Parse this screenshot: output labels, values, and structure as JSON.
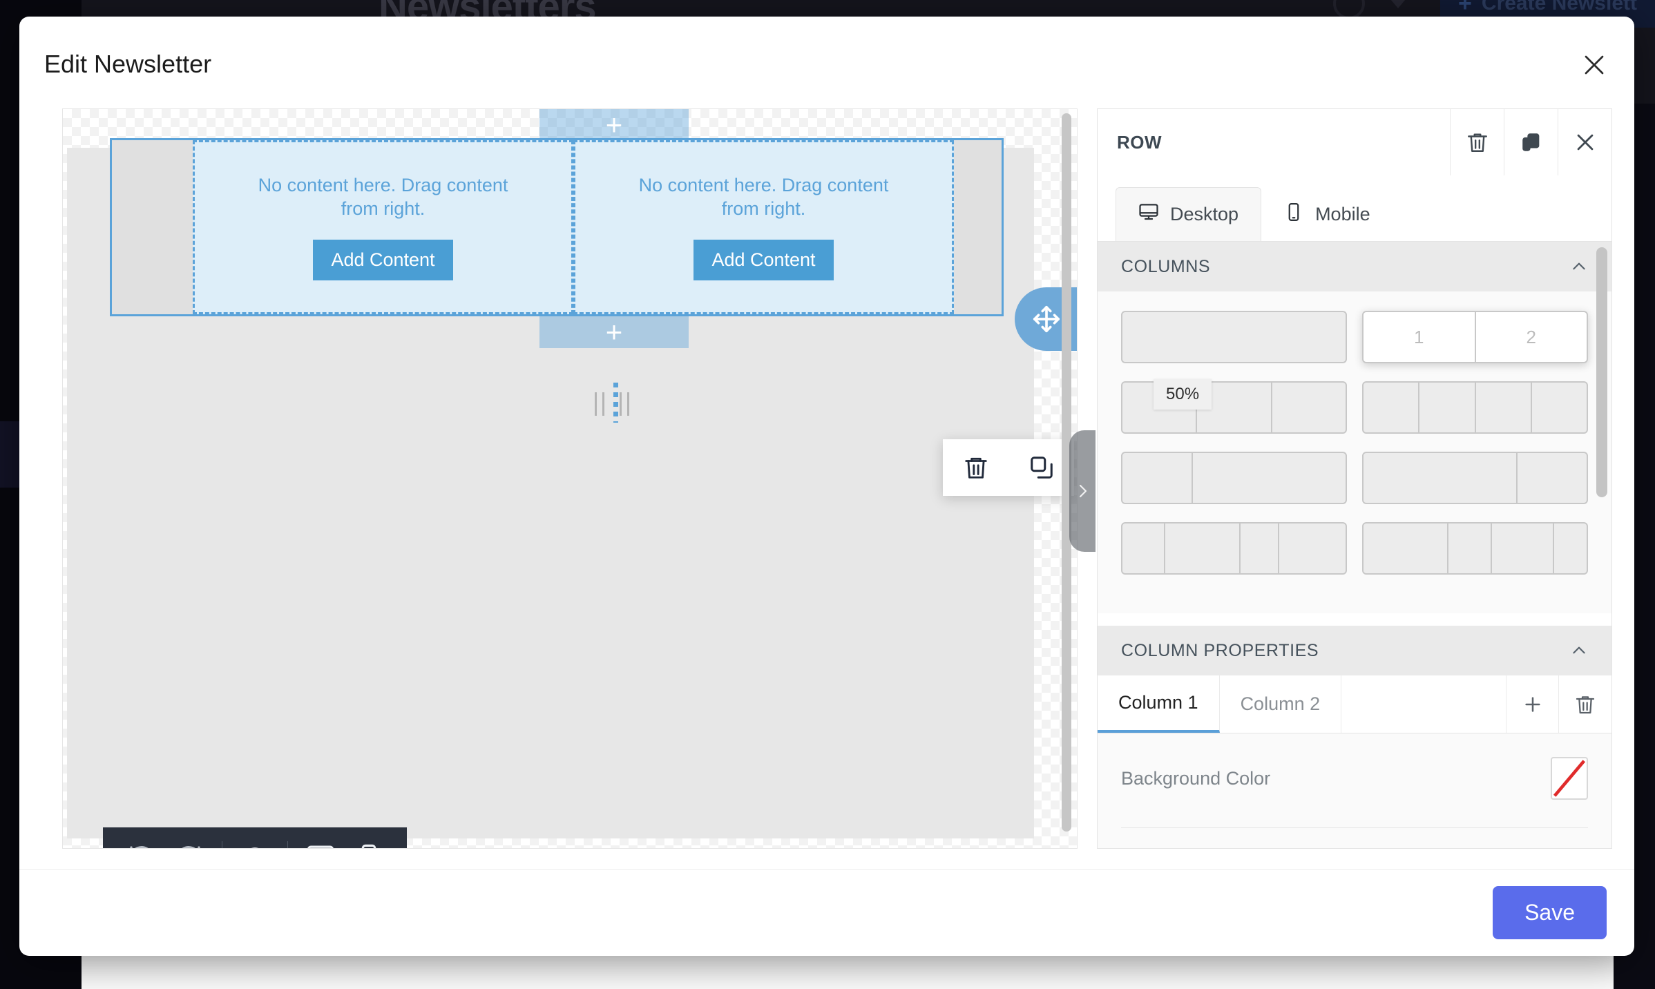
{
  "background": {
    "page_title": "Newsletters",
    "create_button": "Create Newslett",
    "create_icon": "plus-icon",
    "avatar_icon": "avatar-icon",
    "caret_icon": "chevron-down-icon"
  },
  "modal": {
    "title": "Edit Newsletter",
    "close_icon": "close-icon",
    "save_label": "Save"
  },
  "canvas": {
    "columns": [
      {
        "empty_message": "No content here. Drag content from right.",
        "add_button": "Add Content"
      },
      {
        "empty_message": "No content here. Drag content from right.",
        "add_button": "Add Content"
      }
    ],
    "drop_zone_glyph": "+",
    "move_handle_icon": "move-arrows-icon",
    "row_actions": [
      {
        "icon": "trash-icon",
        "name": "delete-row-button"
      },
      {
        "icon": "duplicate-icon",
        "name": "duplicate-row-button"
      }
    ],
    "toolbar": [
      {
        "icon": "undo-icon",
        "name": "undo-button"
      },
      {
        "icon": "redo-icon",
        "name": "redo-button"
      },
      {
        "icon": "eye-icon",
        "name": "preview-button"
      },
      {
        "icon": "desktop-icon",
        "name": "desktop-view-button"
      },
      {
        "icon": "mobile-icon",
        "name": "mobile-view-button"
      }
    ],
    "panel_toggle_icon": "chevron-right-icon"
  },
  "panel": {
    "title": "ROW",
    "header_actions": [
      {
        "icon": "trash-icon",
        "name": "delete-button"
      },
      {
        "icon": "duplicate-icon",
        "name": "duplicate-button"
      },
      {
        "icon": "close-icon",
        "name": "close-panel-button"
      }
    ],
    "device_tabs": [
      {
        "label": "Desktop",
        "icon": "desktop-icon",
        "active": true
      },
      {
        "label": "Mobile",
        "icon": "mobile-icon",
        "active": false
      }
    ],
    "columns_section": {
      "title": "COLUMNS",
      "collapse_icon": "chevron-up-icon",
      "tooltip": "50%",
      "layouts": [
        {
          "cells": [
            ""
          ],
          "selected": false
        },
        {
          "cells": [
            "1",
            "2"
          ],
          "selected": true
        },
        {
          "cells": [
            "",
            "",
            ""
          ],
          "selected": false
        },
        {
          "cells": [
            "",
            "",
            "",
            ""
          ],
          "selected": false
        },
        {
          "cells": [
            "",
            ""
          ],
          "selected": false,
          "weights": [
            1,
            2.2
          ]
        },
        {
          "cells": [
            "",
            ""
          ],
          "selected": false,
          "weights": [
            2.2,
            1
          ]
        },
        {
          "cells": [
            "",
            "",
            "",
            ""
          ],
          "selected": false,
          "weights": [
            1,
            1.8,
            0.9,
            1.6
          ]
        },
        {
          "cells": [
            "",
            "",
            "",
            ""
          ],
          "selected": false,
          "weights": [
            1.8,
            0.9,
            1.3,
            0.7
          ]
        }
      ]
    },
    "column_properties_section": {
      "title": "COLUMN PROPERTIES",
      "collapse_icon": "chevron-up-icon",
      "tabs": [
        {
          "label": "Column 1",
          "active": true
        },
        {
          "label": "Column 2",
          "active": false
        }
      ],
      "tab_actions": [
        {
          "icon": "plus-icon",
          "name": "add-column-button"
        },
        {
          "icon": "trash-icon",
          "name": "delete-column-button"
        }
      ],
      "background_color_label": "Background Color",
      "background_color_value": "none"
    }
  },
  "colors": {
    "accent_blue": "#5ba3d9",
    "save_blue": "#5a6ceb",
    "panel_header_gray": "#eaeaea",
    "toolbar_dark": "#2b313d",
    "swatch_none_stroke": "#e02b2b"
  }
}
